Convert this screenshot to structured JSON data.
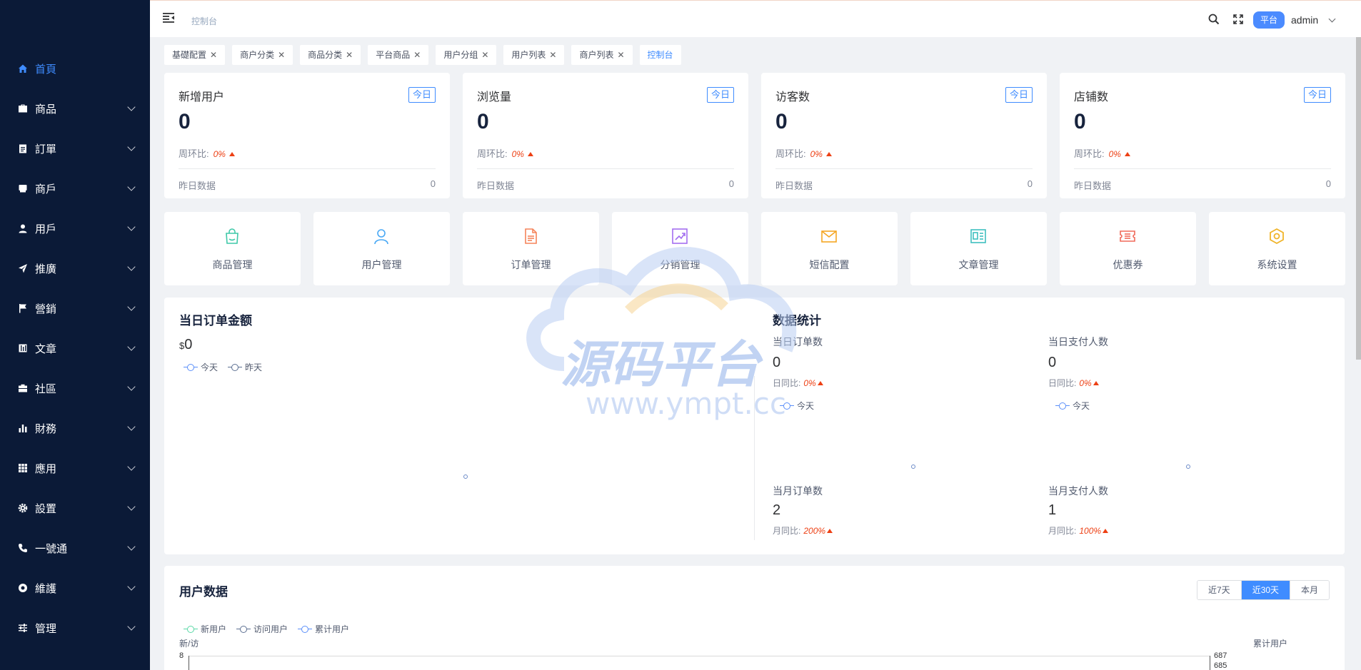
{
  "sidebar": {
    "items": [
      {
        "label": "首頁",
        "icon": "home-icon",
        "active": true
      },
      {
        "label": "商品",
        "icon": "briefcase-icon"
      },
      {
        "label": "訂單",
        "icon": "clipboard-icon"
      },
      {
        "label": "商戶",
        "icon": "store-icon"
      },
      {
        "label": "用戶",
        "icon": "user-icon"
      },
      {
        "label": "推廣",
        "icon": "send-icon"
      },
      {
        "label": "營銷",
        "icon": "flag-icon"
      },
      {
        "label": "文章",
        "icon": "book-icon"
      },
      {
        "label": "社區",
        "icon": "suitcase-icon"
      },
      {
        "label": "財務",
        "icon": "bar-chart-icon"
      },
      {
        "label": "應用",
        "icon": "grid-icon"
      },
      {
        "label": "設置",
        "icon": "gear-icon"
      },
      {
        "label": "一號通",
        "icon": "phone-icon"
      },
      {
        "label": "維護",
        "icon": "globe-icon"
      },
      {
        "label": "管理",
        "icon": "sliders-icon"
      }
    ]
  },
  "header": {
    "breadcrumb": "控制台",
    "platform_badge": "平台",
    "username": "admin"
  },
  "tabs": [
    {
      "label": "基礎配置",
      "closable": true
    },
    {
      "label": "商户分类",
      "closable": true
    },
    {
      "label": "商品分类",
      "closable": true
    },
    {
      "label": "平台商品",
      "closable": true
    },
    {
      "label": "用户分组",
      "closable": true
    },
    {
      "label": "用户列表",
      "closable": true
    },
    {
      "label": "商户列表",
      "closable": true
    },
    {
      "label": "控制台",
      "closable": false,
      "active": true
    }
  ],
  "stats": [
    {
      "title": "新增用户",
      "badge": "今日",
      "value": "0",
      "wow_label": "周环比:",
      "wow_pct": "0%",
      "foot_label": "昨日数据",
      "foot_value": "0"
    },
    {
      "title": "浏览量",
      "badge": "今日",
      "value": "0",
      "wow_label": "周环比:",
      "wow_pct": "0%",
      "foot_label": "昨日数据",
      "foot_value": "0"
    },
    {
      "title": "访客数",
      "badge": "今日",
      "value": "0",
      "wow_label": "周环比:",
      "wow_pct": "0%",
      "foot_label": "昨日数据",
      "foot_value": "0"
    },
    {
      "title": "店铺数",
      "badge": "今日",
      "value": "0",
      "wow_label": "周环比:",
      "wow_pct": "0%",
      "foot_label": "昨日数据",
      "foot_value": "0"
    }
  ],
  "quick_nav": [
    {
      "label": "商品管理",
      "icon": "shopping-bag-icon",
      "color": "#3fc8a8"
    },
    {
      "label": "用户管理",
      "icon": "user-icon",
      "color": "#4aa9f5"
    },
    {
      "label": "订单管理",
      "icon": "document-icon",
      "color": "#f5845a"
    },
    {
      "label": "分销管理",
      "icon": "trend-chart-icon",
      "color": "#a36ef0"
    },
    {
      "label": "短信配置",
      "icon": "envelope-icon",
      "color": "#f5a623"
    },
    {
      "label": "文章管理",
      "icon": "article-icon",
      "color": "#3fbfbf"
    },
    {
      "label": "优惠券",
      "icon": "ticket-icon",
      "color": "#f06a5a"
    },
    {
      "label": "系统设置",
      "icon": "hexagon-gear-icon",
      "color": "#f0b429"
    }
  ],
  "order_amount": {
    "title": "当日订单金额",
    "currency": "$",
    "value": "0",
    "legend": [
      "今天",
      "昨天"
    ]
  },
  "data_stats": {
    "title": "数据统计",
    "blocks": [
      {
        "label": "当日订单数",
        "value": "0",
        "cmp_label": "日同比:",
        "cmp_pct": "0%",
        "legend": "今天"
      },
      {
        "label": "当日支付人数",
        "value": "0",
        "cmp_label": "日同比:",
        "cmp_pct": "0%",
        "legend": "今天"
      },
      {
        "label": "当月订单数",
        "value": "2",
        "cmp_label": "月同比:",
        "cmp_pct": "200%"
      },
      {
        "label": "当月支付人数",
        "value": "1",
        "cmp_label": "月同比:",
        "cmp_pct": "100%"
      }
    ]
  },
  "user_data": {
    "title": "用户数据",
    "ranges": [
      {
        "label": "近7天"
      },
      {
        "label": "近30天",
        "active": true
      },
      {
        "label": "本月"
      }
    ],
    "legend": [
      "新用户",
      "访问用户",
      "累计用户"
    ],
    "left_axis_label": "新/访",
    "right_axis_label": "累计用户",
    "left_tick": "8",
    "right_ticks": [
      "687",
      "685"
    ]
  },
  "watermark": {
    "text": "源码平台",
    "url": "www.ympt.cc"
  },
  "colors": {
    "sidebar_bg": "#0b1a37",
    "accent": "#3f8cff",
    "danger": "#ed4014"
  }
}
